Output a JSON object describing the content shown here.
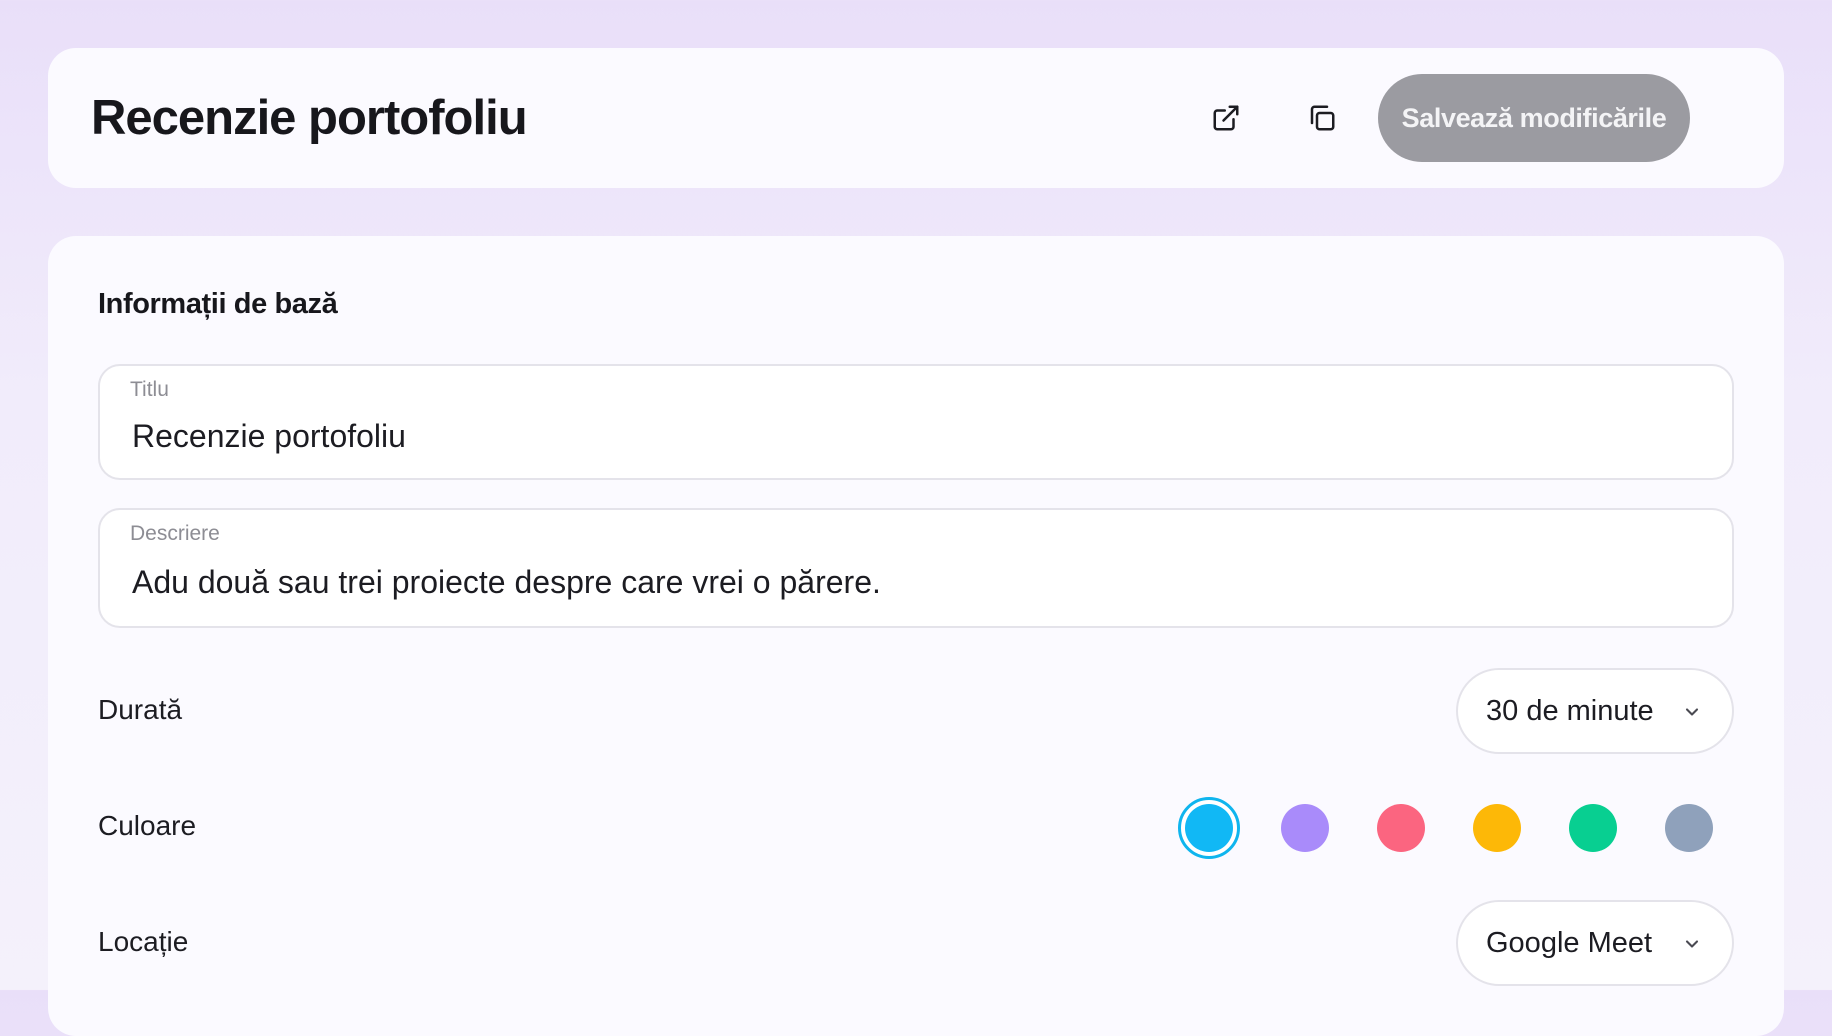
{
  "header": {
    "title": "Recenzie portofoliu",
    "open_link_icon": "external-link-icon",
    "copy_icon": "copy-icon",
    "save_label": "Salvează modificările"
  },
  "basic_info": {
    "section_title": "Informații de bază",
    "title_field": {
      "label": "Titlu",
      "value": "Recenzie portofoliu"
    },
    "description_field": {
      "label": "Descriere",
      "value": "Adu două sau trei proiecte despre care vrei o părere."
    },
    "duration": {
      "label": "Durată",
      "value": "30 de minute"
    },
    "color": {
      "label": "Culoare",
      "selected_index": 0,
      "options": [
        "#11b8f5",
        "#a98bfa",
        "#fb6580",
        "#fdb807",
        "#08cf91",
        "#8fa1bb"
      ]
    },
    "location": {
      "label": "Locație",
      "value": "Google Meet"
    }
  }
}
